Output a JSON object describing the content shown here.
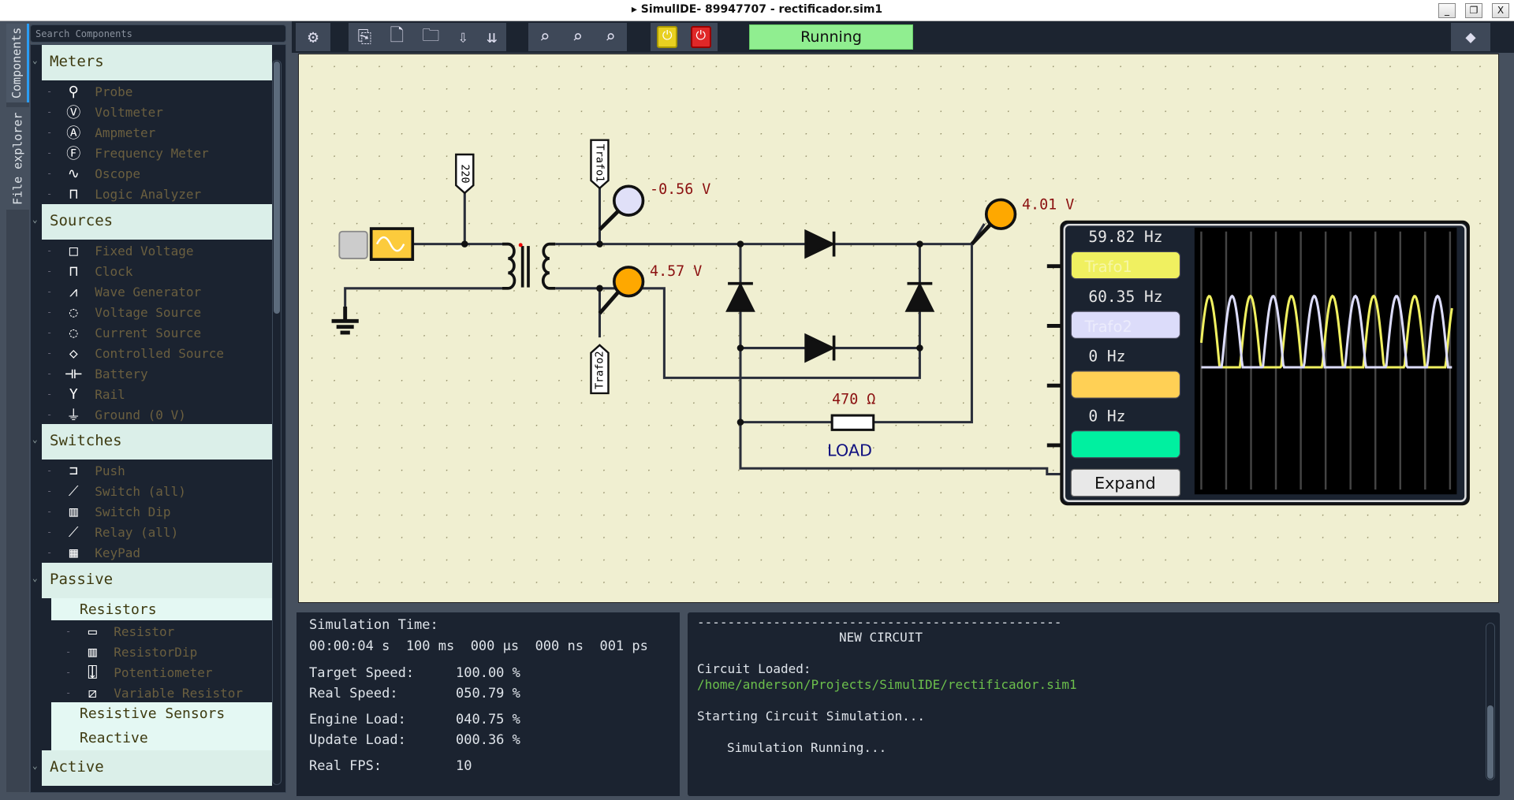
{
  "window": {
    "title": "▸ SimulIDE- 89947707 - rectificador.sim1",
    "minimize": "_",
    "maximize": "❐",
    "close": "X"
  },
  "side_tabs": {
    "components": "Components",
    "file_explorer": "File explorer"
  },
  "search": {
    "placeholder": "Search Components"
  },
  "tree": {
    "meters": {
      "label": "Meters",
      "items": [
        {
          "label": "Probe",
          "icon": "⚲"
        },
        {
          "label": "Voltmeter",
          "icon": "Ⓥ"
        },
        {
          "label": "Ampmeter",
          "icon": "Ⓐ"
        },
        {
          "label": "Frequency Meter",
          "icon": "Ⓕ"
        },
        {
          "label": "Oscope",
          "icon": "∿"
        },
        {
          "label": "Logic Analyzer",
          "icon": "⊓"
        }
      ]
    },
    "sources": {
      "label": "Sources",
      "items": [
        {
          "label": "Fixed Voltage",
          "icon": "□"
        },
        {
          "label": "Clock",
          "icon": "⊓"
        },
        {
          "label": "Wave Generator",
          "icon": "⩘"
        },
        {
          "label": "Voltage Source",
          "icon": "◌"
        },
        {
          "label": "Current Source",
          "icon": "◌"
        },
        {
          "label": "Controlled Source",
          "icon": "◇"
        },
        {
          "label": "Battery",
          "icon": "⊣⊢"
        },
        {
          "label": "Rail",
          "icon": "Y"
        },
        {
          "label": "Ground (0 V)",
          "icon": "⏚"
        }
      ]
    },
    "switches": {
      "label": "Switches",
      "items": [
        {
          "label": "Push",
          "icon": "⊐"
        },
        {
          "label": "Switch (all)",
          "icon": "⟋"
        },
        {
          "label": "Switch Dip",
          "icon": "▥"
        },
        {
          "label": "Relay (all)",
          "icon": "⟋"
        },
        {
          "label": "KeyPad",
          "icon": "▦"
        }
      ]
    },
    "passive": {
      "label": "Passive",
      "resistors": {
        "label": "Resistors",
        "items": [
          {
            "label": "Resistor",
            "icon": "▭"
          },
          {
            "label": "ResistorDip",
            "icon": "▥"
          },
          {
            "label": "Potentiometer",
            "icon": "⍗"
          },
          {
            "label": "Variable Resistor",
            "icon": "⧄"
          }
        ]
      },
      "resistive_sensors": "Resistive Sensors",
      "reactive": "Reactive"
    },
    "active": {
      "label": "Active"
    }
  },
  "toolbar": {
    "status": "Running",
    "status_color": "#90ee90"
  },
  "circuit": {
    "tags": {
      "input": "220",
      "trafo1": "Trafo1",
      "trafo2": "Trafo2"
    },
    "probes": {
      "p1": "-0.56 V",
      "p2": "4.57 V",
      "p3": "4.01 V"
    },
    "resistor": {
      "value": "470 Ω",
      "name": "LOAD"
    },
    "oscope": {
      "channels": [
        {
          "freq": "59.82 Hz",
          "label": "Trafo1",
          "color": "#f0f060"
        },
        {
          "freq": "60.35 Hz",
          "label": "Trafo2",
          "color": "#dcdcfa"
        },
        {
          "freq": "0 Hz",
          "label": "",
          "color": "#ffd055"
        },
        {
          "freq": "0 Hz",
          "label": "",
          "color": "#00f0a0"
        }
      ],
      "expand": "Expand"
    }
  },
  "sim_info": {
    "time_label": "Simulation Time:",
    "time_value": "00:00:04 s  100 ms  000 µs  000 ns  001 ps",
    "target_speed_label": "Target Speed:",
    "target_speed": "100.00 %",
    "real_speed_label": "Real Speed:",
    "real_speed": "050.79 %",
    "engine_load_label": "Engine Load:",
    "engine_load": "040.75 %",
    "update_load_label": "Update Load:",
    "update_load": "000.36 %",
    "fps_label": "Real FPS:",
    "fps": "10"
  },
  "console": {
    "separator": "------------------------------------------------",
    "heading": "NEW CIRCUIT",
    "loaded": "Circuit Loaded:",
    "path": "/home/anderson/Projects/SimulIDE/rectificador.sim1",
    "starting": "Starting Circuit Simulation...",
    "running": "Simulation Running..."
  }
}
